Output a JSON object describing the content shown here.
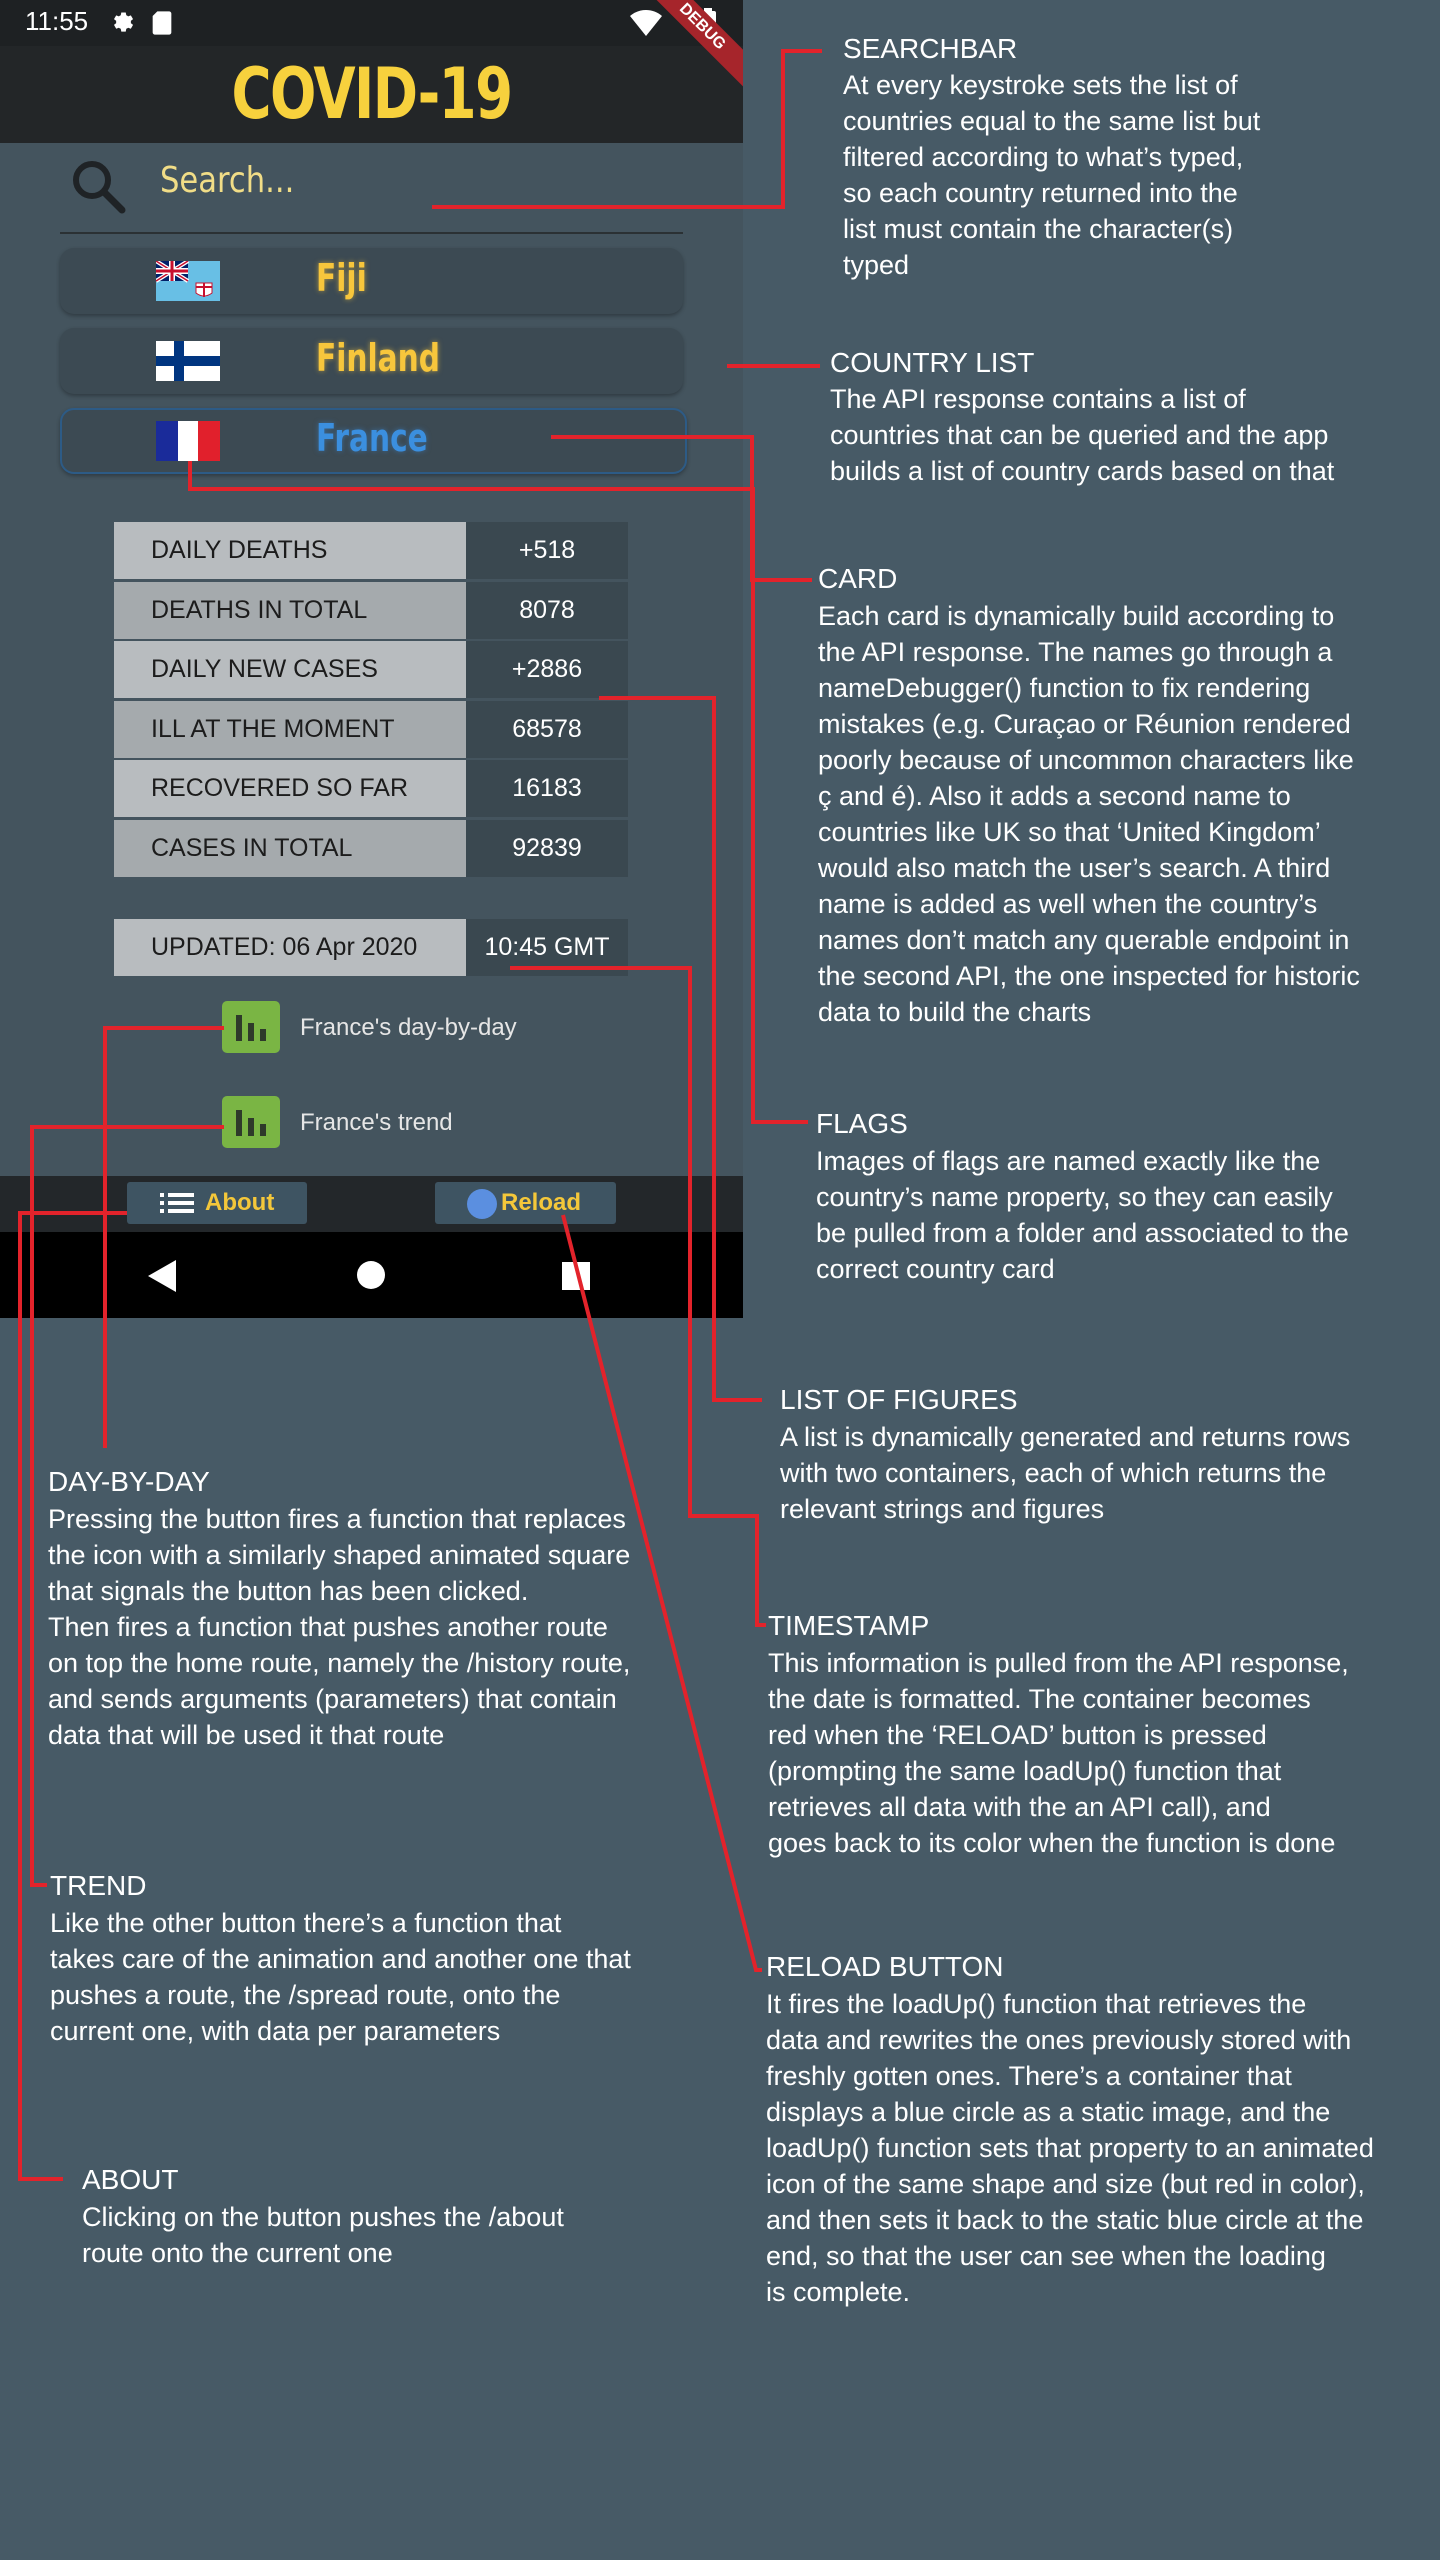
{
  "status_bar": {
    "time": "11:55",
    "debug_label": "DEBUG"
  },
  "app": {
    "title": "COVID-19"
  },
  "search": {
    "placeholder": "Search..."
  },
  "countries": [
    {
      "name": "Fiji",
      "active": false
    },
    {
      "name": "Finland",
      "active": false
    },
    {
      "name": "France",
      "active": true
    }
  ],
  "figures": [
    {
      "label": "DAILY DEATHS",
      "value": "+518"
    },
    {
      "label": "DEATHS IN TOTAL",
      "value": "8078"
    },
    {
      "label": "DAILY NEW CASES",
      "value": "+2886"
    },
    {
      "label": "ILL AT THE MOMENT",
      "value": "68578"
    },
    {
      "label": "RECOVERED SO FAR",
      "value": "16183"
    },
    {
      "label": "CASES IN TOTAL",
      "value": "92839"
    }
  ],
  "updated": {
    "date": "UPDATED: 06 Apr 2020",
    "time": "10:45 GMT"
  },
  "actions": {
    "day_by_day": "France's day-by-day",
    "trend": "France's trend"
  },
  "bottom_bar": {
    "about": "About",
    "reload": "Reload"
  },
  "annotations": {
    "searchbar": {
      "title": "SEARCHBAR",
      "body": "At every keystroke sets the list of\ncountries equal to the same list but\nfiltered according to what’s typed,\nso each country returned into the\nlist must contain the character(s)\ntyped"
    },
    "country_list": {
      "title": "COUNTRY LIST",
      "body": "The API response contains a list of\ncountries that can be queried and the app\nbuilds a list of country cards based on that"
    },
    "card": {
      "title": "CARD",
      "body": "Each card is dynamically build according to\nthe API response. The names go through a\nnameDebugger() function to fix rendering\nmistakes (e.g. Curaçao or Réunion rendered\npoorly because of uncommon characters like\nç and é). Also it adds a second name to\ncountries like UK so that ‘United Kingdom’\nwould also match the user’s search. A third\nname is added as well when the country’s\nnames don’t match any querable endpoint in\nthe second API, the one inspected for historic\ndata to build the charts"
    },
    "flags": {
      "title": "FLAGS",
      "body": "Images of flags are named exactly like the\ncountry’s name property, so they can easily\nbe pulled from a folder and associated to the\ncorrect country card"
    },
    "list_of_figures": {
      "title": "LIST OF FIGURES",
      "body": "A list is dynamically generated and returns rows\nwith two containers, each of which returns the\nrelevant strings and figures"
    },
    "day_by_day": {
      "title": "DAY-BY-DAY",
      "body": "Pressing the button fires a function that replaces\nthe icon with a similarly shaped animated square\nthat signals the button has been clicked.\nThen fires a function that pushes another route\non top the home route, namely the /history route,\nand sends arguments (parameters) that contain\ndata that will be used it that route"
    },
    "timestamp": {
      "title": "TIMESTAMP",
      "body": "This information is pulled from the API response,\nthe date is formatted. The container becomes\nred when the ‘RELOAD’ button is pressed\n(prompting the same loadUp() function that\nretrieves all data with the an API call), and\ngoes back to its color when the function is done"
    },
    "trend": {
      "title": "TREND",
      "body": "Like the other button there’s a function that\ntakes care of the animation and another one that\npushes a route, the /spread route, onto the\ncurrent one, with data per parameters"
    },
    "reload_button": {
      "title": "RELOAD BUTTON",
      "body": "It fires the loadUp() function that retrieves the\ndata and rewrites the ones previously stored with\nfreshly gotten ones. There’s a container that\ndisplays a blue circle as a static image, and the\nloadUp() function sets that property to an animated\nicon of the same shape and size (but red in color),\nand then sets it back to the static blue circle at the\nend, so that the user can see when the loading\nis complete."
    },
    "about": {
      "title": "ABOUT",
      "body": "Clicking on the button pushes the /about\nroute onto the current one"
    }
  },
  "colors": {
    "background": "#475a66",
    "accent_yellow": "#f7c63c",
    "accent_blue": "#3b8fdf",
    "chart_button_green": "#7ab544",
    "annotation_line_red": "#e3232b"
  }
}
